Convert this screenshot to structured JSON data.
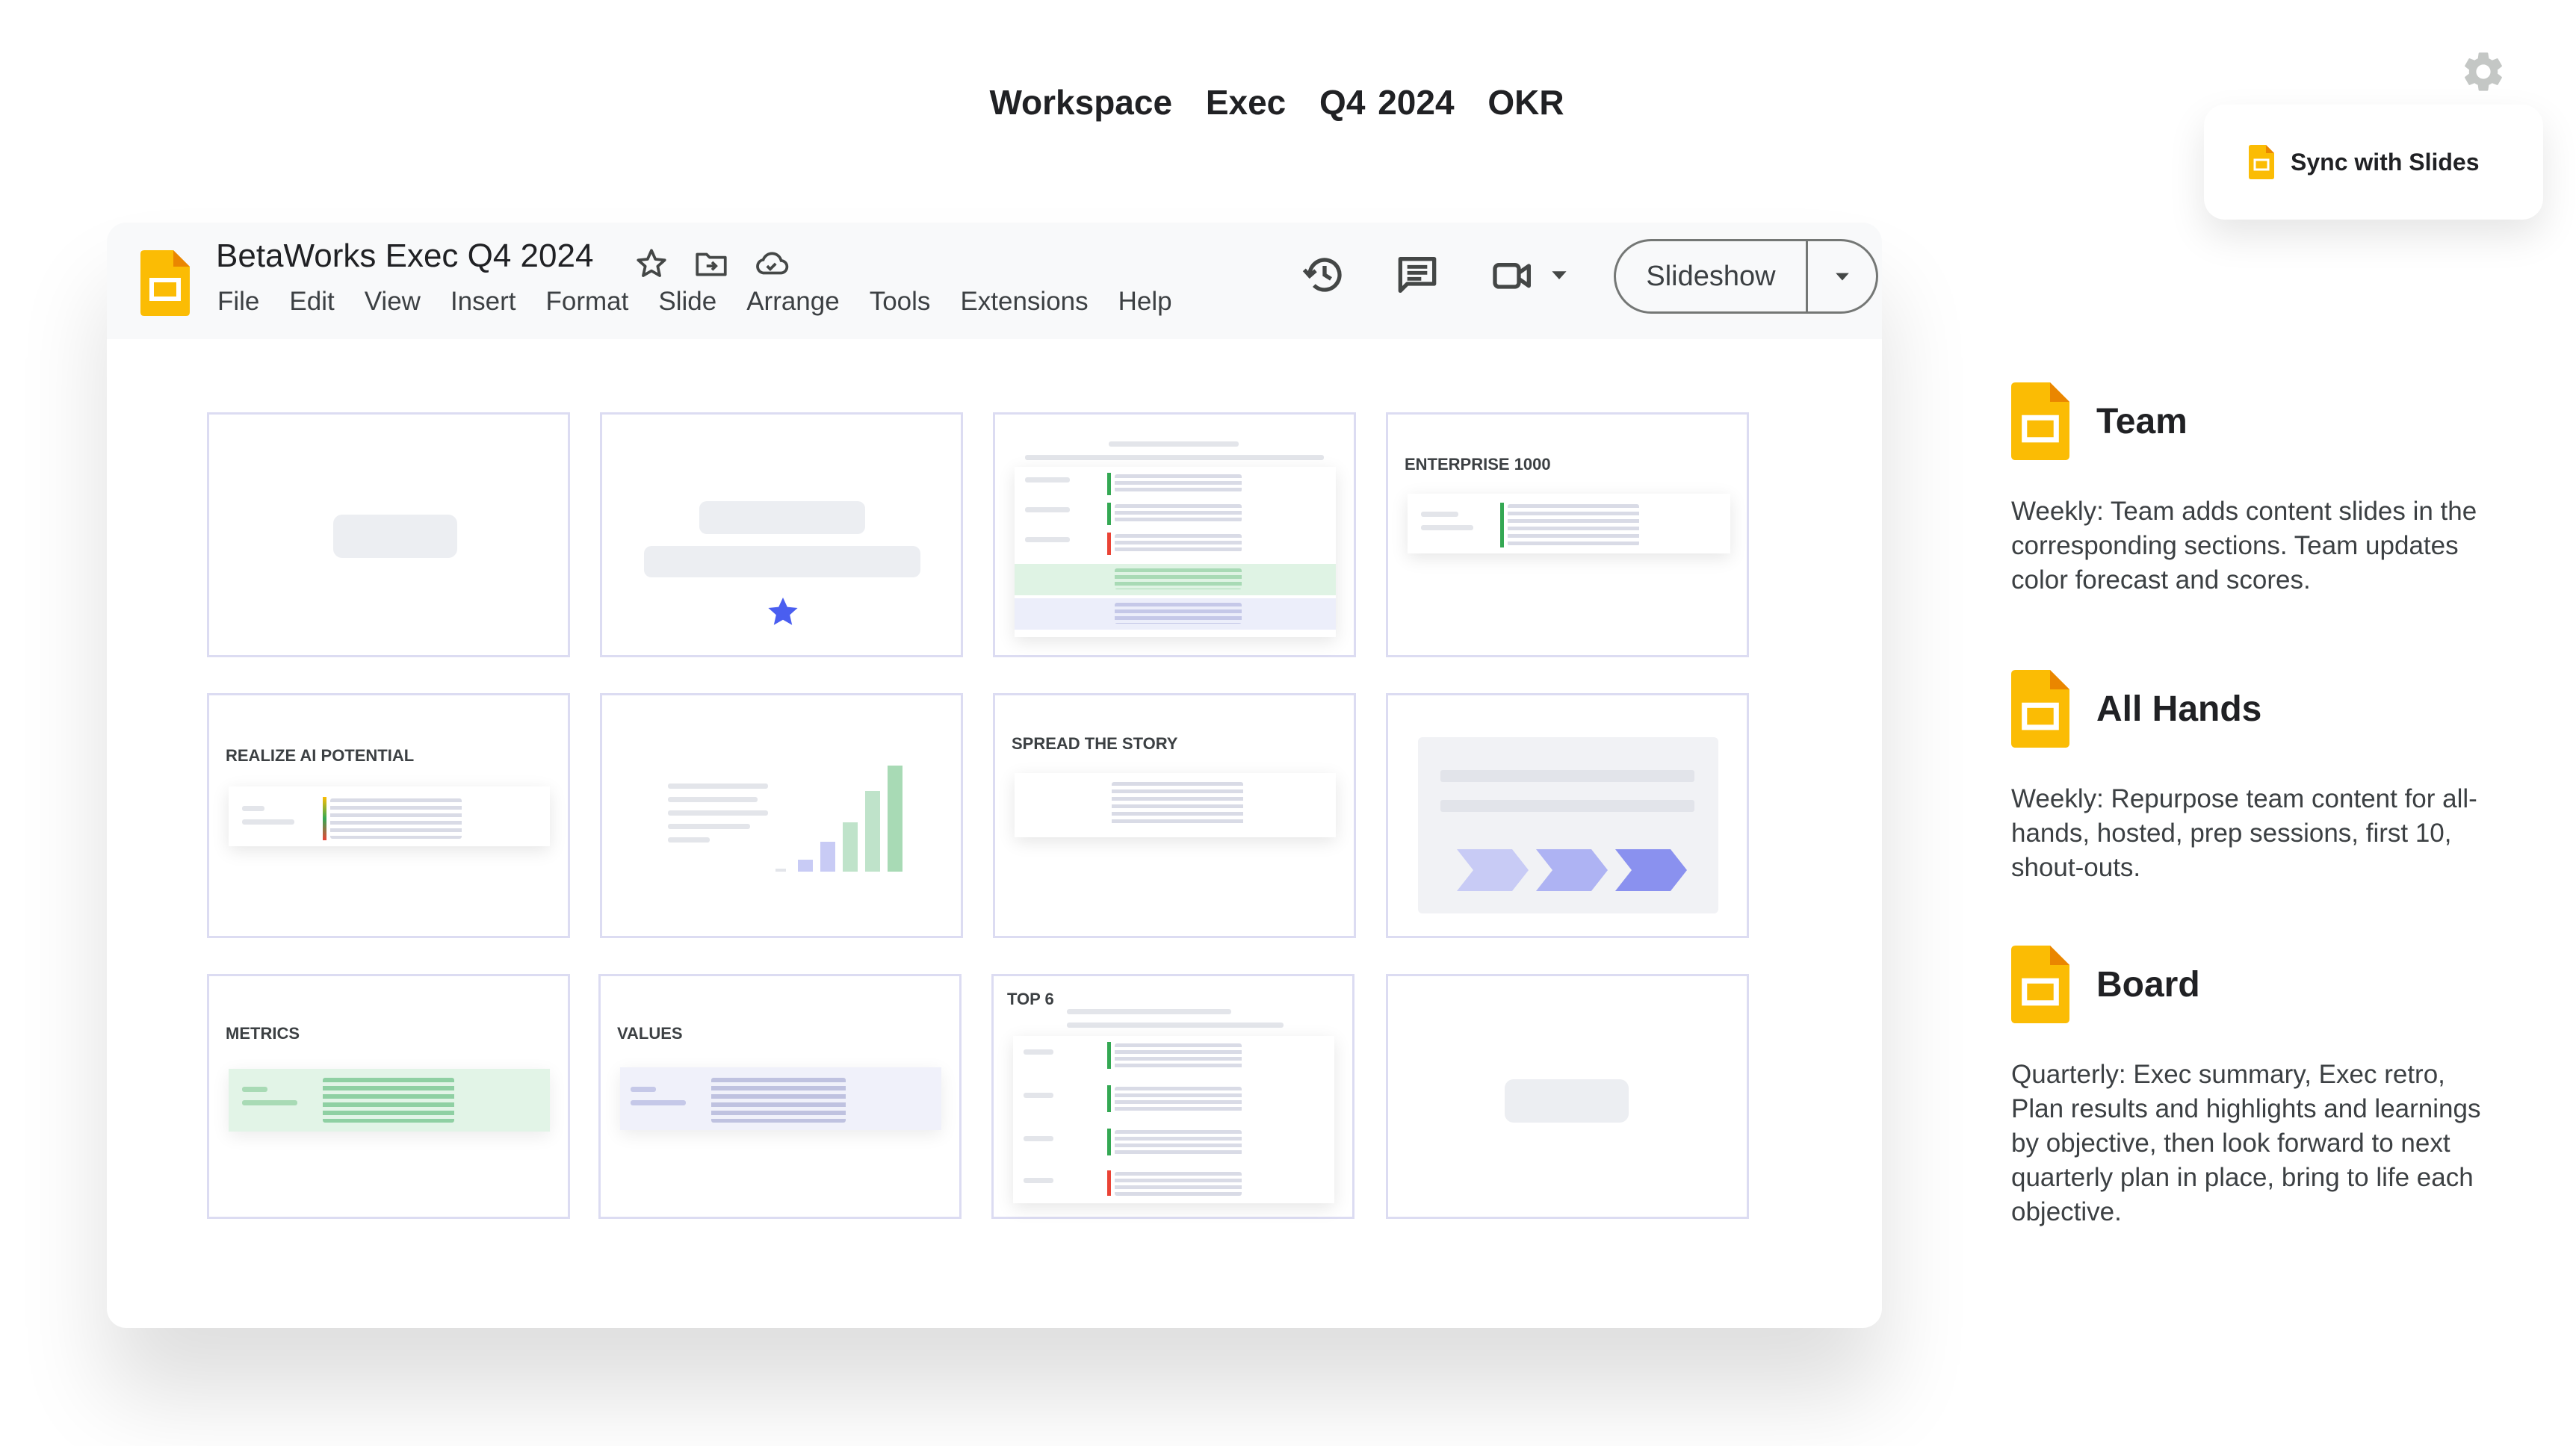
{
  "header": {
    "words": [
      "Workspace",
      "Exec",
      "Q4 2024",
      "OKR"
    ]
  },
  "sync_button": {
    "label": "Sync with Slides"
  },
  "app": {
    "doc_title": "BetaWorks Exec Q4 2024",
    "menu": [
      "File",
      "Edit",
      "View",
      "Insert",
      "Format",
      "Slide",
      "Arrange",
      "Tools",
      "Extensions",
      "Help"
    ],
    "slideshow_label": "Slideshow"
  },
  "slides": {
    "enterprise": "ENTERPRISE 1000",
    "realize_ai": "REALIZE AI POTENTIAL",
    "spread_story": "SPREAD THE STORY",
    "metrics": "METRICS",
    "values": "VALUES",
    "top6": "TOP 6"
  },
  "sections": [
    {
      "title": "Team",
      "description": "Weekly:  Team adds content slides in the corresponding sections.  Team updates color forecast and scores."
    },
    {
      "title": "All Hands",
      "description": "Weekly:  Repurpose team content for all-hands, hosted, prep sessions, first 10, shout-outs."
    },
    {
      "title": "Board",
      "description": "Quarterly:  Exec summary,  Exec retro,  Plan results and highlights and learnings by objective, then look forward to next quarterly plan in place, bring to life each objective."
    }
  ],
  "colors": {
    "slides_yellow": "#fbbc04",
    "slides_yellow_dark": "#ea8600",
    "accent_blue": "#4a5ef0",
    "green": "#34a853"
  },
  "icons": [
    "gear-icon",
    "slides-icon",
    "star-icon",
    "move-folder-icon",
    "cloud-icon",
    "history-icon",
    "comment-icon",
    "video-call-icon",
    "dropdown-arrow-icon"
  ]
}
